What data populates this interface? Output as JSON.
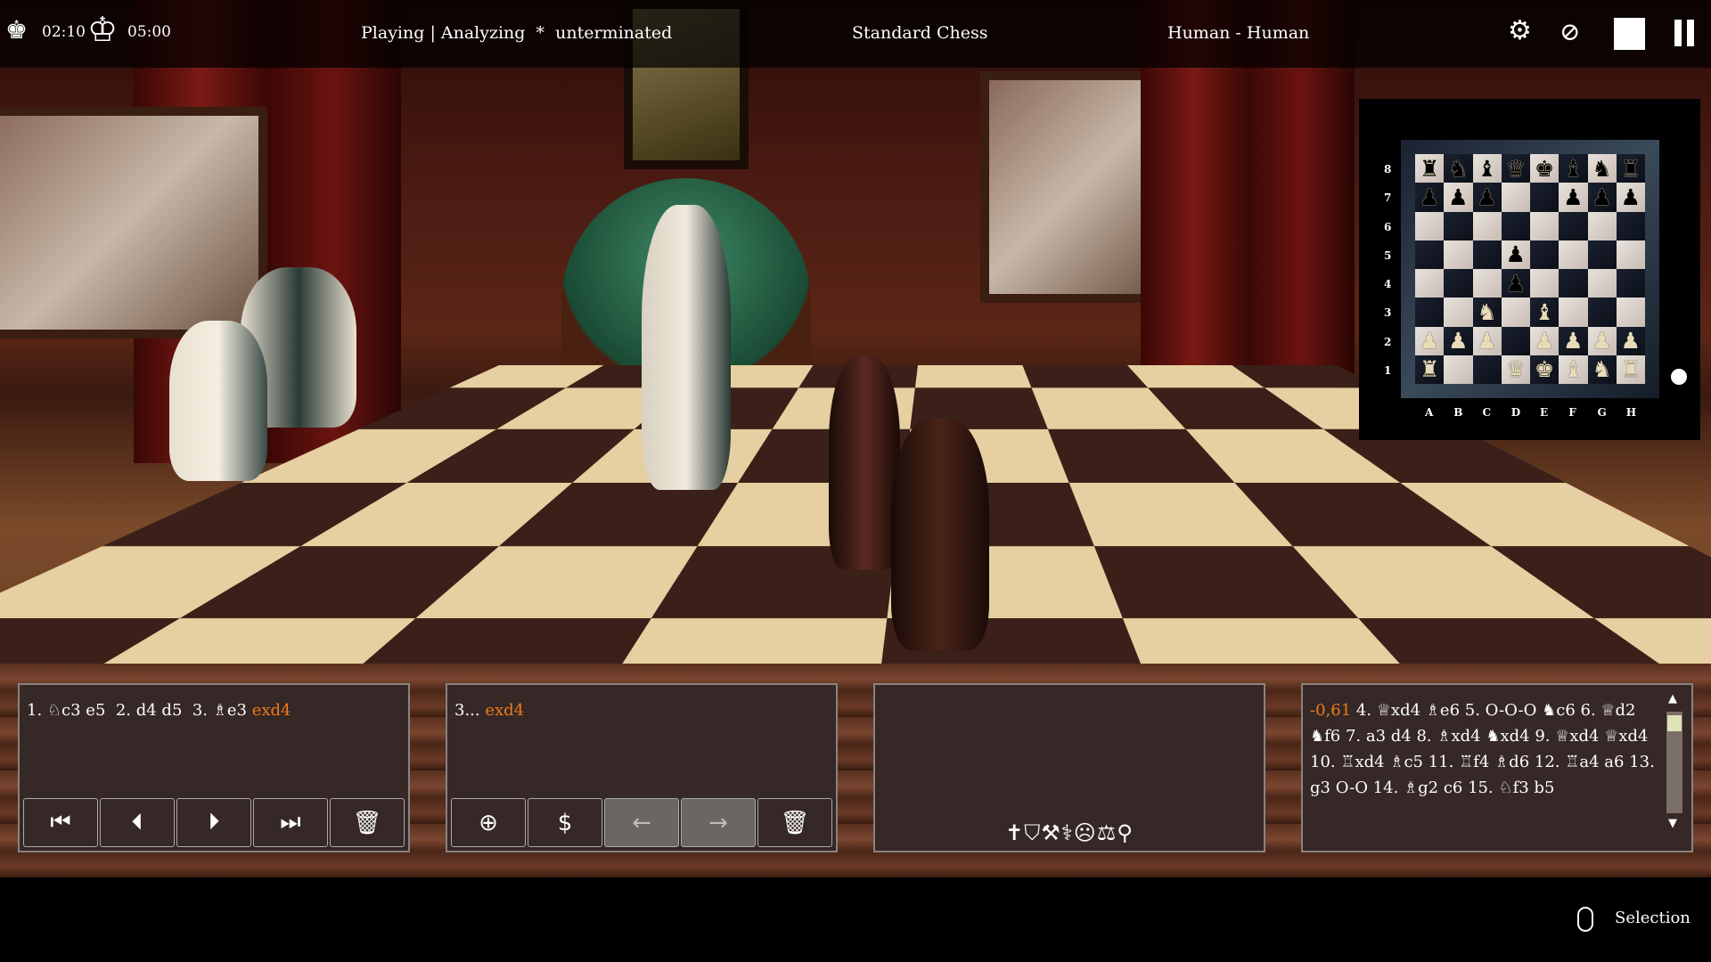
{
  "topbar": {
    "white_clock": "02:10",
    "black_clock": "05:00",
    "status": "Playing | Analyzing  *  unterminated",
    "variant": "Standard Chess",
    "players": "Human - Human",
    "icons": [
      "white-king-icon",
      "black-king-icon",
      "gear-icon",
      "hide-view-icon",
      "white-square-icon",
      "pause-icon"
    ]
  },
  "minimap": {
    "ranks": [
      "8",
      "7",
      "6",
      "5",
      "4",
      "3",
      "2",
      "1"
    ],
    "files": [
      "A",
      "B",
      "C",
      "D",
      "E",
      "F",
      "G",
      "H"
    ],
    "position": [
      "rnbqkbnr",
      "ppp..ppp",
      "........",
      "...p....",
      "...p....",
      "..N.B...",
      "PPP.PPPP",
      "R..QKBNR"
    ],
    "side_to_move": "white"
  },
  "moves_panel": {
    "segments": [
      {
        "t": "1. ♘c3 e5  2. d4 d5  3. ♗e3 ",
        "hl": false
      },
      {
        "t": "exd4",
        "hl": true
      }
    ],
    "buttons": [
      {
        "name": "first-move-button",
        "icon": "⏮"
      },
      {
        "name": "previous-move-button",
        "icon": "⏴"
      },
      {
        "name": "next-move-button",
        "icon": "⏵"
      },
      {
        "name": "last-move-button",
        "icon": "⏭"
      },
      {
        "name": "delete-moves-button",
        "icon": "🗑"
      }
    ]
  },
  "comment_panel": {
    "prefix": "3... ",
    "move": "exd4",
    "buttons": [
      {
        "name": "add-comment-button",
        "icon": "⊕",
        "disabled": false
      },
      {
        "name": "annotation-button",
        "icon": "$",
        "disabled": false
      },
      {
        "name": "comment-back-button",
        "icon": "←",
        "disabled": true
      },
      {
        "name": "comment-forward-button",
        "icon": "→",
        "disabled": true
      },
      {
        "name": "delete-comment-button",
        "icon": "🗑",
        "disabled": false
      }
    ]
  },
  "tools_panel": {
    "icons": "✝⛉⚒⚕☹⚖⚲"
  },
  "analysis_panel": {
    "score": "-0,61",
    "line": " 4. ♕xd4 ♗e6 5. O-O-O ♞c6 6. ♕d2 ♞f6 7. a3 d4 8. ♗xd4 ♞xd4 9. ♕xd4 ♕xd4 10. ♖xd4 ♗c5 11. ♖f4 ♗d6 12. ♖a4 a6 13. g3 O-O 14. ♗g2 c6 15. ♘f3 b5"
  },
  "statusbar": {
    "mode": "Selection"
  },
  "colors": {
    "highlight": "#f07a1a",
    "panel": "#352826",
    "light_square": "#e6cfa0",
    "dark_square": "#3a2018"
  }
}
